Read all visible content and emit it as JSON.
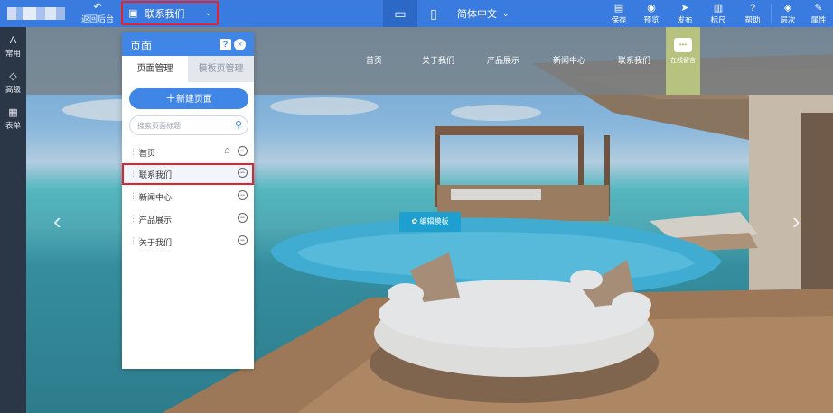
{
  "topbar": {
    "back_label": "返回后台",
    "current_page": "联系我们",
    "language": "简体中文",
    "tools": [
      {
        "label": "保存",
        "icon": "save-icon"
      },
      {
        "label": "预览",
        "icon": "eye-icon"
      },
      {
        "label": "发布",
        "icon": "send-icon"
      },
      {
        "label": "标尺",
        "icon": "ruler-icon"
      },
      {
        "label": "帮助",
        "icon": "help-icon"
      },
      {
        "label": "层次",
        "icon": "layers-icon"
      },
      {
        "label": "属性",
        "icon": "brush-icon"
      }
    ]
  },
  "leftrail": {
    "items": [
      {
        "label": "常用",
        "icon": "A"
      },
      {
        "label": "高级",
        "icon": "◇"
      },
      {
        "label": "表单",
        "icon": "▦"
      }
    ]
  },
  "site": {
    "nav": [
      "首页",
      "关于我们",
      "产品展示",
      "新闻中心",
      "联系我们"
    ],
    "message_label": "在线留言",
    "edit_template_label": "编辑模板"
  },
  "panel": {
    "title": "页面",
    "help": "?",
    "close": "×",
    "tabs": [
      "页面管理",
      "模板页管理"
    ],
    "new_page_label": "新建页面",
    "search_placeholder": "搜索页面标题",
    "pages": [
      {
        "label": "首页",
        "home": true
      },
      {
        "label": "联系我们",
        "selected": true
      },
      {
        "label": "新闻中心"
      },
      {
        "label": "产品展示"
      },
      {
        "label": "关于我们"
      }
    ]
  },
  "colors": {
    "toolbar": "#3a7be0",
    "rail": "#2b3646",
    "panel_accent": "#3f86e6",
    "highlight": "#e5232e",
    "message_box": "#b6c27e",
    "edit_button": "#1da0cf"
  }
}
